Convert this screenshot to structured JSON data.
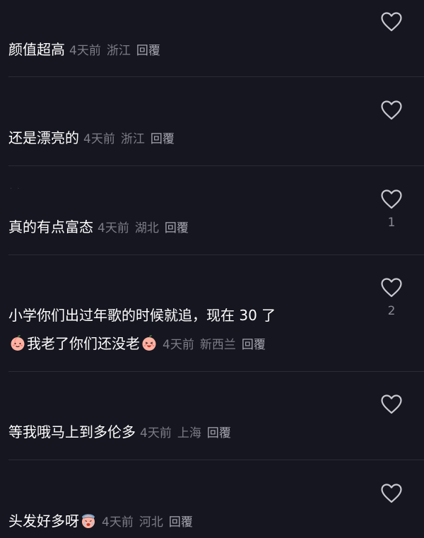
{
  "comments": [
    {
      "text": "颜值超高",
      "time": "4天前",
      "location": "浙江",
      "reply": "回覆",
      "likes": ""
    },
    {
      "text": "还是漂亮的",
      "time": "4天前",
      "location": "浙江",
      "reply": "回覆",
      "likes": ""
    },
    {
      "text": "真的有点富态",
      "time": "4天前",
      "location": "湖北",
      "reply": "回覆",
      "likes": "1"
    },
    {
      "text_line1": "小学你们出过年歌的时候就追，现在 30 了",
      "text_line2": "我老了你们还没老",
      "time": "4天前",
      "location": "新西兰",
      "reply": "回覆",
      "likes": "2",
      "emojis": [
        "peach-smile-emoji",
        "peach-laugh-emoji"
      ]
    },
    {
      "text": "等我哦马上到多伦多",
      "time": "4天前",
      "location": "上海",
      "reply": "回覆",
      "likes": ""
    },
    {
      "text": "头发好多呀",
      "time": "4天前",
      "location": "河北",
      "reply": "回覆",
      "likes": "",
      "emojis": [
        "peach-cry-emoji"
      ]
    }
  ],
  "colors": {
    "background": "#161620",
    "text": "#ffffff",
    "meta": "#7d7d88",
    "divider": "#2b2b36"
  }
}
